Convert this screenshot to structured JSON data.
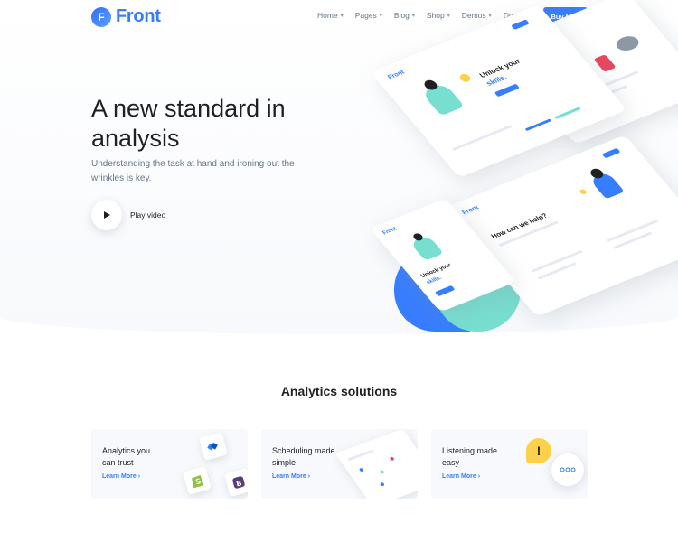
{
  "nav": {
    "logo_letter": "F",
    "logo_text": "Front",
    "menu": [
      {
        "label": "Home"
      },
      {
        "label": "Pages"
      },
      {
        "label": "Blog"
      },
      {
        "label": "Shop"
      },
      {
        "label": "Demos"
      },
      {
        "label": "Docs"
      }
    ],
    "buy_label": "Buy Now"
  },
  "hero": {
    "title": "A new standard in analysis",
    "subtitle": "Understanding the task at hand and ironing out the wrinkles is key.",
    "play_label": "Play video",
    "mockup": {
      "logo": "Front",
      "unlock_line1": "Unlock your",
      "unlock_line2": "skills.",
      "help_title": "How can we help?"
    }
  },
  "solutions": {
    "title": "Analytics solutions",
    "cards": [
      {
        "title": "Analytics you can trust",
        "link": "Learn More"
      },
      {
        "title": "Scheduling made simple",
        "link": "Learn More"
      },
      {
        "title": "Listening made easy",
        "link": "Learn More"
      }
    ]
  },
  "colors": {
    "primary": "#377dff",
    "teal": "#77dfd0",
    "text_dark": "#1e2022",
    "text_muted": "#677788",
    "card_bg": "#f7f9fc"
  }
}
